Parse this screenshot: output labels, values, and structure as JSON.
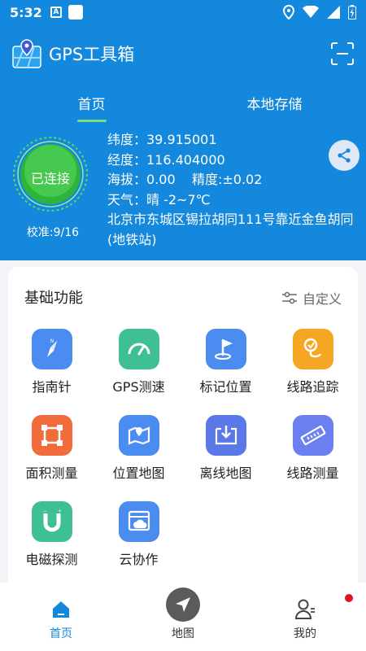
{
  "status_bar": {
    "time": "5:32",
    "app_badge": "A"
  },
  "header": {
    "title": "GPS工具箱",
    "logo_icon": "gps-logo-icon",
    "scan_icon": "scan-icon"
  },
  "tabs": [
    {
      "label": "首页",
      "active": true
    },
    {
      "label": "本地存储",
      "active": false
    }
  ],
  "gps_status": {
    "connection": "已连接",
    "calibration": "校准:9/16",
    "latitude_line": "纬度：39.915001",
    "longitude_line": "经度：116.404000",
    "altitude_line": "海拔：0.00    精度:±0.02",
    "weather_line": "天气：晴 -2~7℃",
    "address": "北京市东城区锡拉胡同111号靠近金鱼胡同(地铁站)"
  },
  "basic_functions": {
    "title": "基础功能",
    "customize_label": "自定义",
    "items": [
      {
        "label": "指南针",
        "icon": "compass-icon",
        "color": "#4a8cf0"
      },
      {
        "label": "GPS测速",
        "icon": "speedometer-icon",
        "color": "#3fbf94"
      },
      {
        "label": "标记位置",
        "icon": "flag-icon",
        "color": "#4a8cf0"
      },
      {
        "label": "线路追踪",
        "icon": "route-track-icon",
        "color": "#f5a623"
      },
      {
        "label": "面积测量",
        "icon": "area-measure-icon",
        "color": "#f26b3a"
      },
      {
        "label": "位置地图",
        "icon": "location-map-icon",
        "color": "#4a8cf0"
      },
      {
        "label": "离线地图",
        "icon": "offline-map-icon",
        "color": "#5a78e8"
      },
      {
        "label": "线路测量",
        "icon": "ruler-icon",
        "color": "#6b7ff0"
      },
      {
        "label": "电磁探测",
        "icon": "magnet-icon",
        "color": "#3fbf94"
      },
      {
        "label": "云协作",
        "icon": "cloud-icon",
        "color": "#4a8cf0"
      }
    ]
  },
  "bottom_nav": [
    {
      "label": "首页",
      "icon": "home-icon",
      "active": true
    },
    {
      "label": "地图",
      "icon": "navigation-arrow-icon",
      "active": false
    },
    {
      "label": "我的",
      "icon": "user-icon",
      "active": false
    }
  ]
}
